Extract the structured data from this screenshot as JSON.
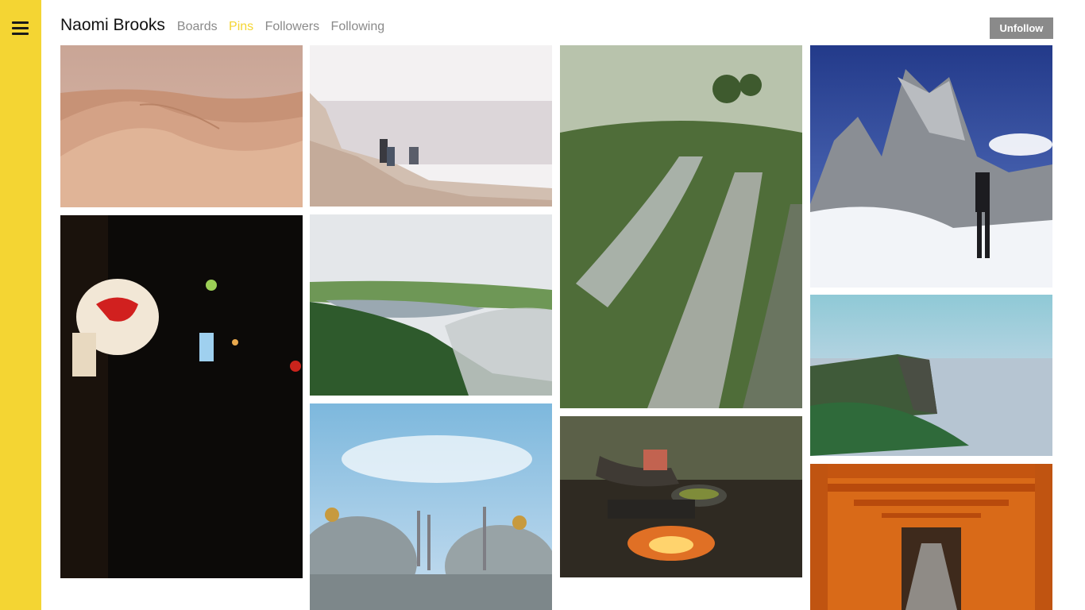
{
  "profile": {
    "name": "Naomi Brooks",
    "tabs": [
      {
        "label": "Boards",
        "active": false
      },
      {
        "label": "Pins",
        "active": true
      },
      {
        "label": "Followers",
        "active": false
      },
      {
        "label": "Following",
        "active": false
      }
    ],
    "unfollow_label": "Unfollow"
  },
  "theme": {
    "accent": "#f4d533",
    "nav_text": "#8a8a8a",
    "button_bg": "#8a8a8a"
  },
  "icons": {
    "menu": "hamburger-menu-icon"
  }
}
